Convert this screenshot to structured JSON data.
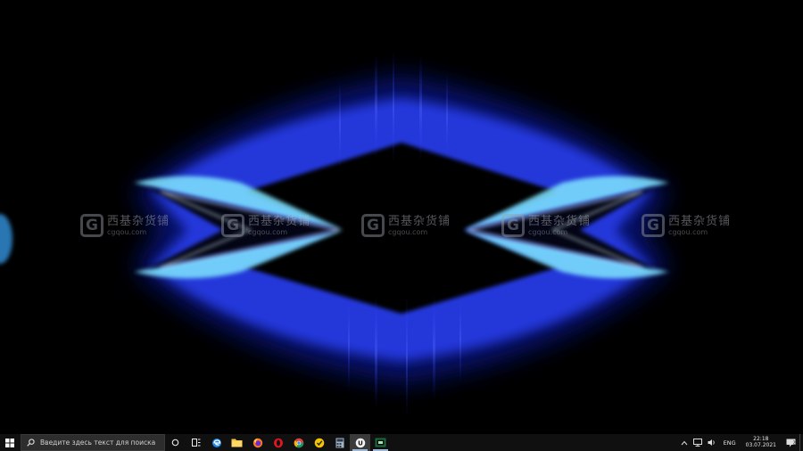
{
  "desktop": {
    "watermark": {
      "cn": "西基杂货铺",
      "url": "cgqou.com"
    }
  },
  "taskbar": {
    "search_placeholder": "Введите здесь текст для поиска",
    "apps": [
      {
        "name": "task-view",
        "icon": "task-view-icon"
      },
      {
        "name": "widgets",
        "icon": "timeline-icon"
      },
      {
        "name": "edge",
        "icon": "edge-icon"
      },
      {
        "name": "file-explorer",
        "icon": "folder-icon"
      },
      {
        "name": "firefox",
        "icon": "firefox-icon"
      },
      {
        "name": "opera",
        "icon": "opera-icon"
      },
      {
        "name": "chrome",
        "icon": "chrome-icon"
      },
      {
        "name": "norton",
        "icon": "shield-icon"
      },
      {
        "name": "calculator",
        "icon": "calculator-icon"
      },
      {
        "name": "unreal-engine",
        "icon": "unreal-icon"
      },
      {
        "name": "media-app",
        "icon": "media-icon"
      }
    ],
    "tray": {
      "language": "ENG",
      "time": "22:18",
      "date": "03.07.2021"
    }
  }
}
